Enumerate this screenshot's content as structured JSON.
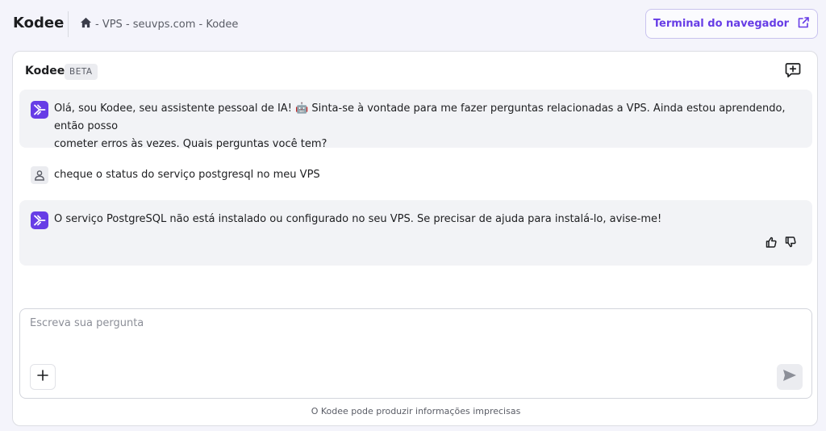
{
  "app": {
    "title": "Kodee"
  },
  "breadcrumb": {
    "path": "- VPS - seuvps.com - Kodee"
  },
  "header": {
    "terminal_label": "Terminal do navegador"
  },
  "chat": {
    "title": "Kodee",
    "badge": "BETA",
    "messages": [
      {
        "role": "assistant",
        "text_line1": "Olá, sou Kodee, seu assistente pessoal de IA! 🤖 Sinta-se à vontade para me fazer perguntas relacionadas a VPS. Ainda estou aprendendo, então posso",
        "text_line2": "cometer erros às vezes. Quais perguntas você tem?"
      },
      {
        "role": "user",
        "text": "cheque o status do serviço postgresql no meu VPS"
      },
      {
        "role": "assistant",
        "text": "O serviço PostgreSQL não está instalado ou configurado no seu VPS. Se precisar de ajuda para instalá-lo, avise-me!"
      }
    ]
  },
  "composer": {
    "placeholder": "Escreva sua pergunta",
    "value": ""
  },
  "footer": {
    "disclaimer": "O Kodee pode produzir informações imprecisas"
  },
  "colors": {
    "accent": "#673de6",
    "background": "#f4f4fb",
    "bubble": "#f2f3f6"
  },
  "icons": {
    "home": "home-icon",
    "external": "external-link-icon",
    "new_chat": "new-chat-icon",
    "bot": "kodee-bot-icon",
    "user": "user-icon",
    "thumbs_up": "thumbs-up-icon",
    "thumbs_down": "thumbs-down-icon",
    "plus": "plus-icon",
    "send": "send-icon"
  }
}
